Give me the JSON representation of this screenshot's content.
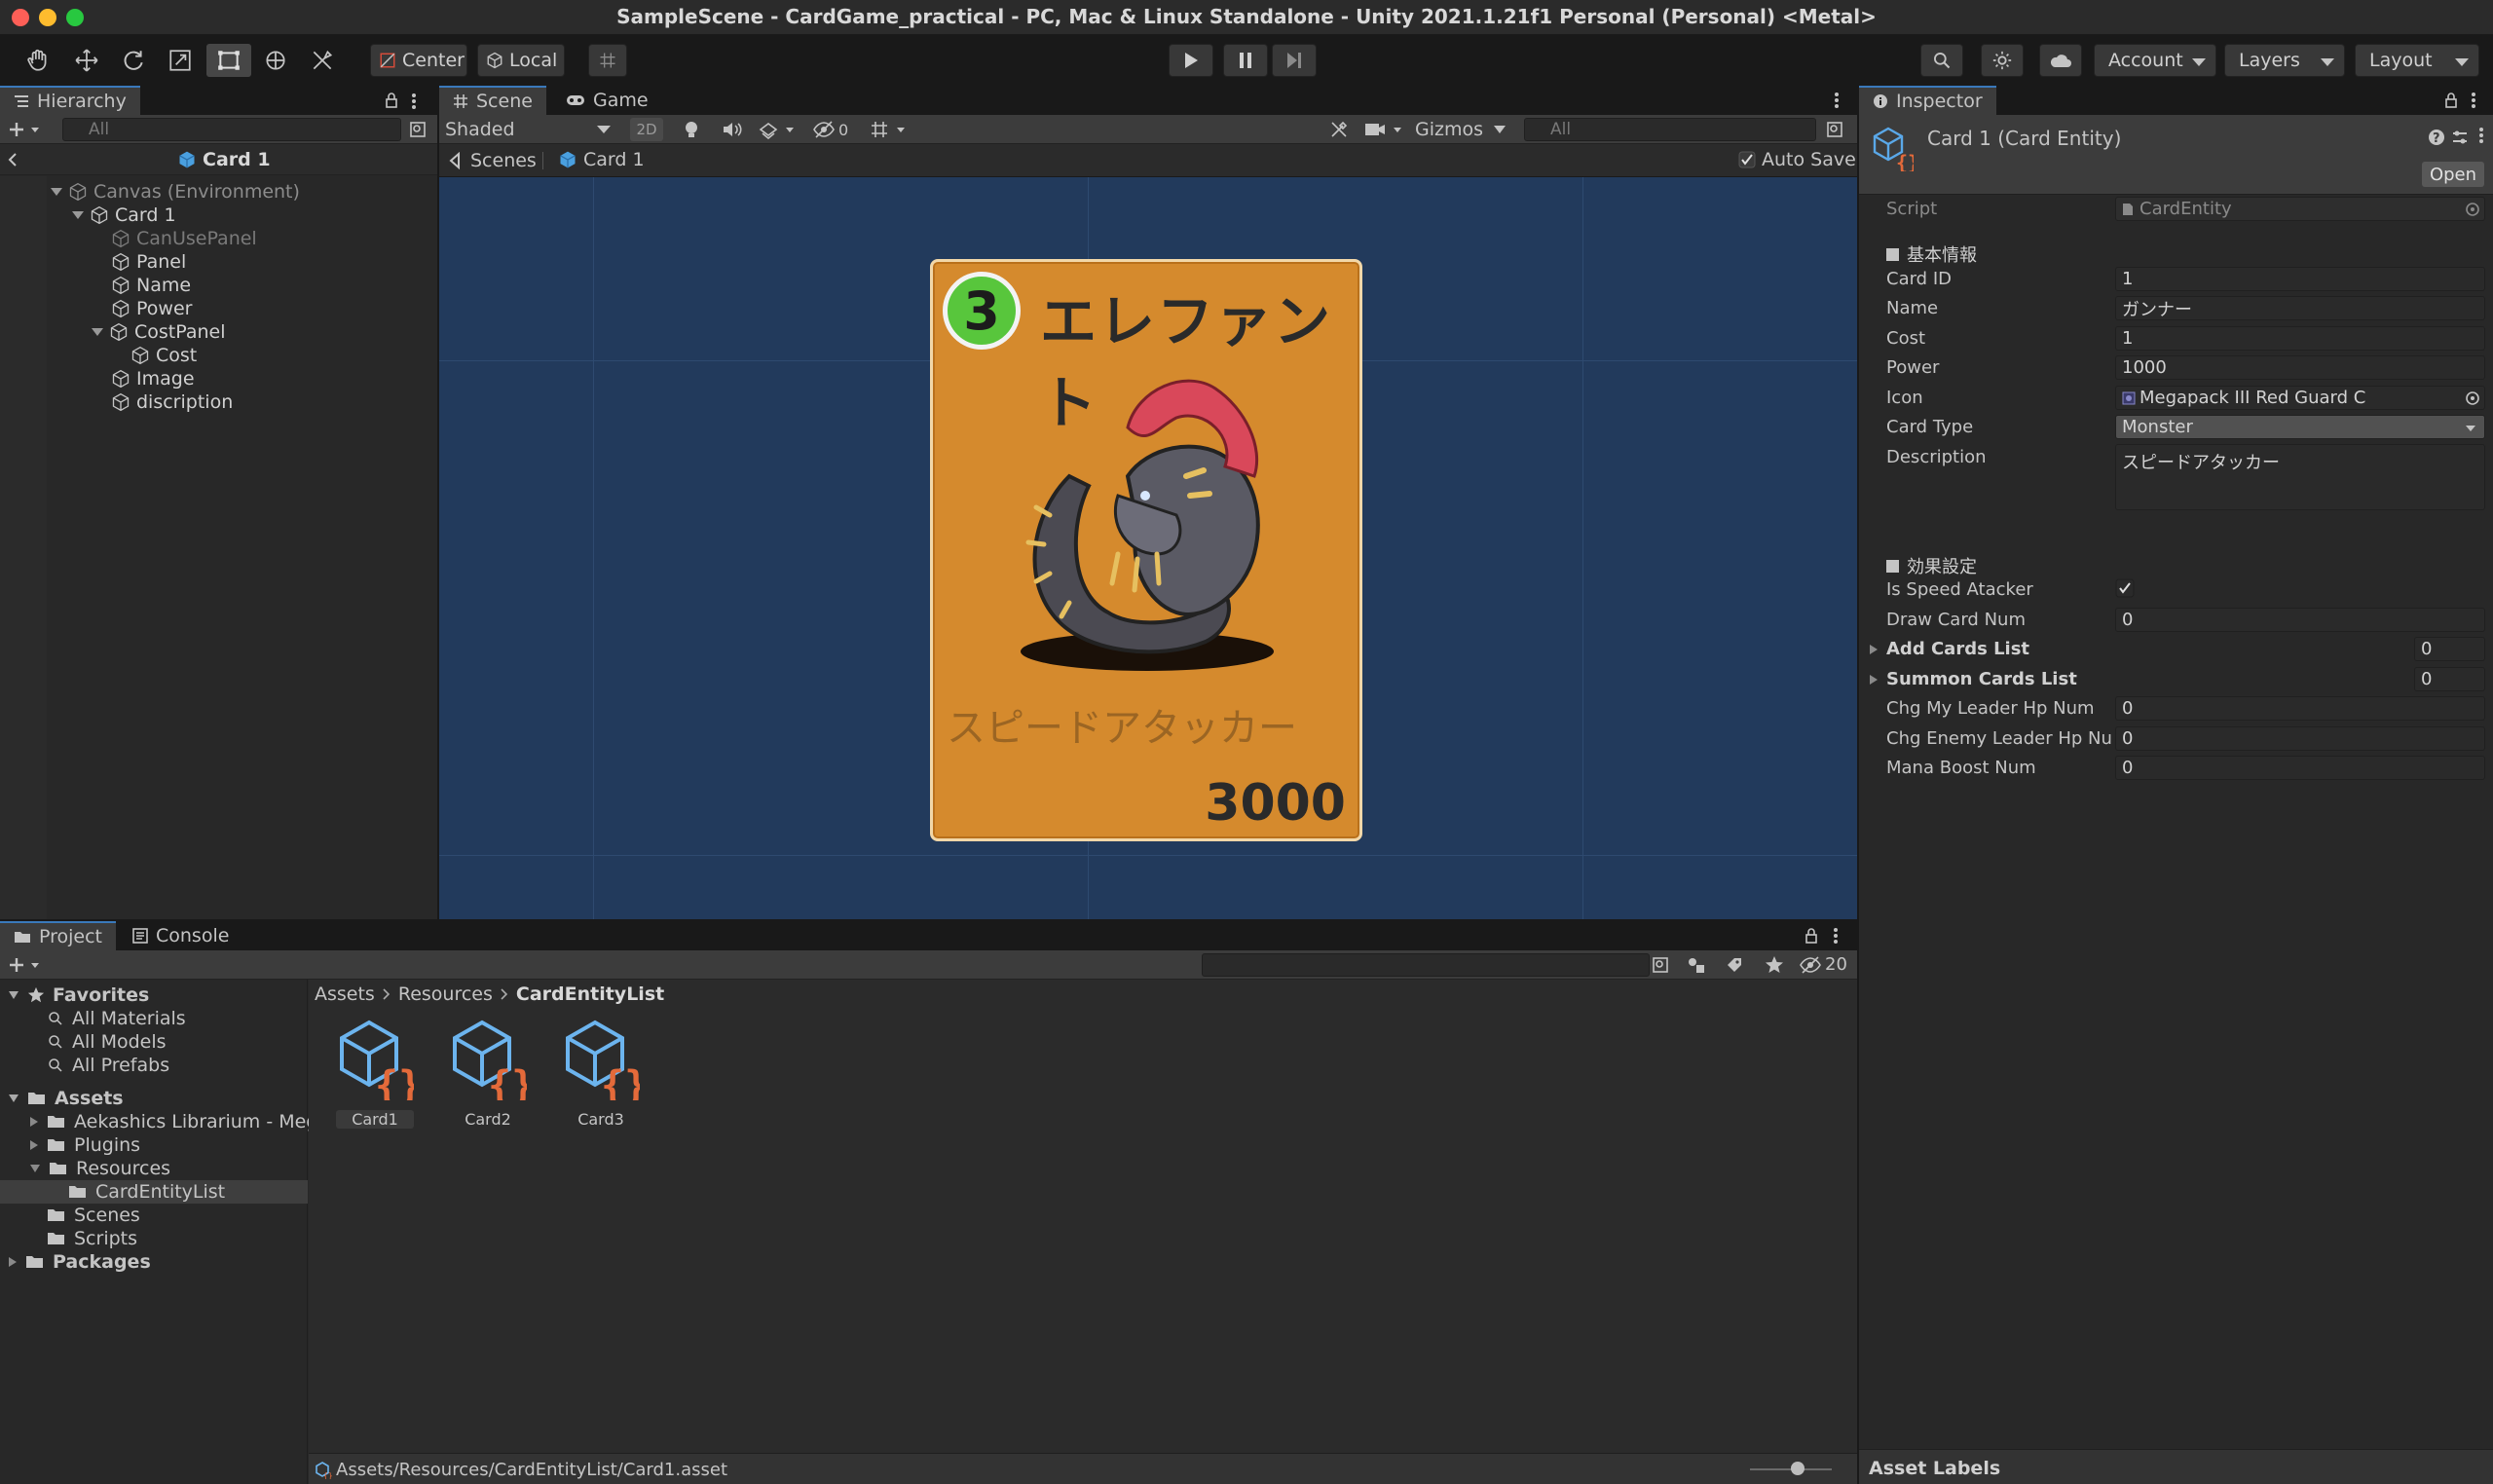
{
  "window": {
    "title": "SampleScene - CardGame_practical - PC, Mac & Linux Standalone - Unity 2021.1.21f1 Personal (Personal) <Metal>",
    "traffic_colors": [
      "#fe5f57",
      "#febc2e",
      "#28c840"
    ]
  },
  "toolbar": {
    "pivot_label": "Center",
    "space_label": "Local",
    "account_label": "Account",
    "layers_label": "Layers",
    "layout_label": "Layout"
  },
  "hierarchy": {
    "tab_label": "Hierarchy",
    "search_placeholder": "All",
    "breadcrumb": "Card 1",
    "items": [
      {
        "label": "Canvas (Environment)"
      },
      {
        "label": "Card 1"
      },
      {
        "label": "CanUsePanel"
      },
      {
        "label": "Panel"
      },
      {
        "label": "Name"
      },
      {
        "label": "Power"
      },
      {
        "label": "CostPanel"
      },
      {
        "label": "Cost"
      },
      {
        "label": "Image"
      },
      {
        "label": "discription"
      }
    ]
  },
  "scene": {
    "tabs": [
      "Scene",
      "Game"
    ],
    "shading_mode": "Shaded",
    "mode_2d": "2D",
    "hidden_count": "0",
    "gizmos_label": "Gizmos",
    "search_placeholder": "All",
    "breadcrumb_root": "Scenes",
    "breadcrumb_current": "Card 1",
    "auto_save_label": "Auto Save",
    "background_color": "#223a5c"
  },
  "card": {
    "cost": "3",
    "name": "エレファント",
    "description": "スピードアタッカー",
    "power": "3000",
    "card_color": "#d58a2d",
    "cost_color": "#58c63c"
  },
  "inspector": {
    "tab_label": "Inspector",
    "object_title": "Card 1 (Card Entity)",
    "open_label": "Open",
    "script_label": "Script",
    "script_value": "CardEntity",
    "section1": "基本情報",
    "fields1": [
      {
        "label": "Card ID",
        "value": "1"
      },
      {
        "label": "Name",
        "value": "ガンナー"
      },
      {
        "label": "Cost",
        "value": "1"
      },
      {
        "label": "Power",
        "value": "1000"
      },
      {
        "label": "Icon",
        "value": "Megapack III Red Guard C"
      },
      {
        "label": "Card Type",
        "value": "Monster"
      },
      {
        "label": "Description",
        "value": "スピードアタッカー"
      }
    ],
    "section2": "効果設定",
    "is_speed_label": "Is Speed Atacker",
    "draw_card_label": "Draw Card Num",
    "draw_card_value": "0",
    "add_cards_label": "Add Cards List",
    "add_cards_value": "0",
    "summon_cards_label": "Summon Cards List",
    "summon_cards_value": "0",
    "chg_my_label": "Chg My Leader Hp Num",
    "chg_my_value": "0",
    "chg_enemy_label": "Chg Enemy Leader Hp Num",
    "chg_enemy_value": "0",
    "mana_boost_label": "Mana Boost Num",
    "mana_boost_value": "0",
    "asset_labels": "Asset Labels"
  },
  "project": {
    "tabs": [
      "Project",
      "Console"
    ],
    "hidden_count": "20",
    "favorites_label": "Favorites",
    "favorites": [
      "All Materials",
      "All Models",
      "All Prefabs"
    ],
    "assets_label": "Assets",
    "asset_folders": [
      "Aekashics Librarium - Mega",
      "Plugins",
      "Resources",
      "CardEntityList",
      "Scenes",
      "Scripts"
    ],
    "packages_label": "Packages",
    "breadcrumb": [
      "Assets",
      "Resources",
      "CardEntityList"
    ],
    "items": [
      "Card1",
      "Card2",
      "Card3"
    ],
    "status_path": "Assets/Resources/CardEntityList/Card1.asset"
  }
}
